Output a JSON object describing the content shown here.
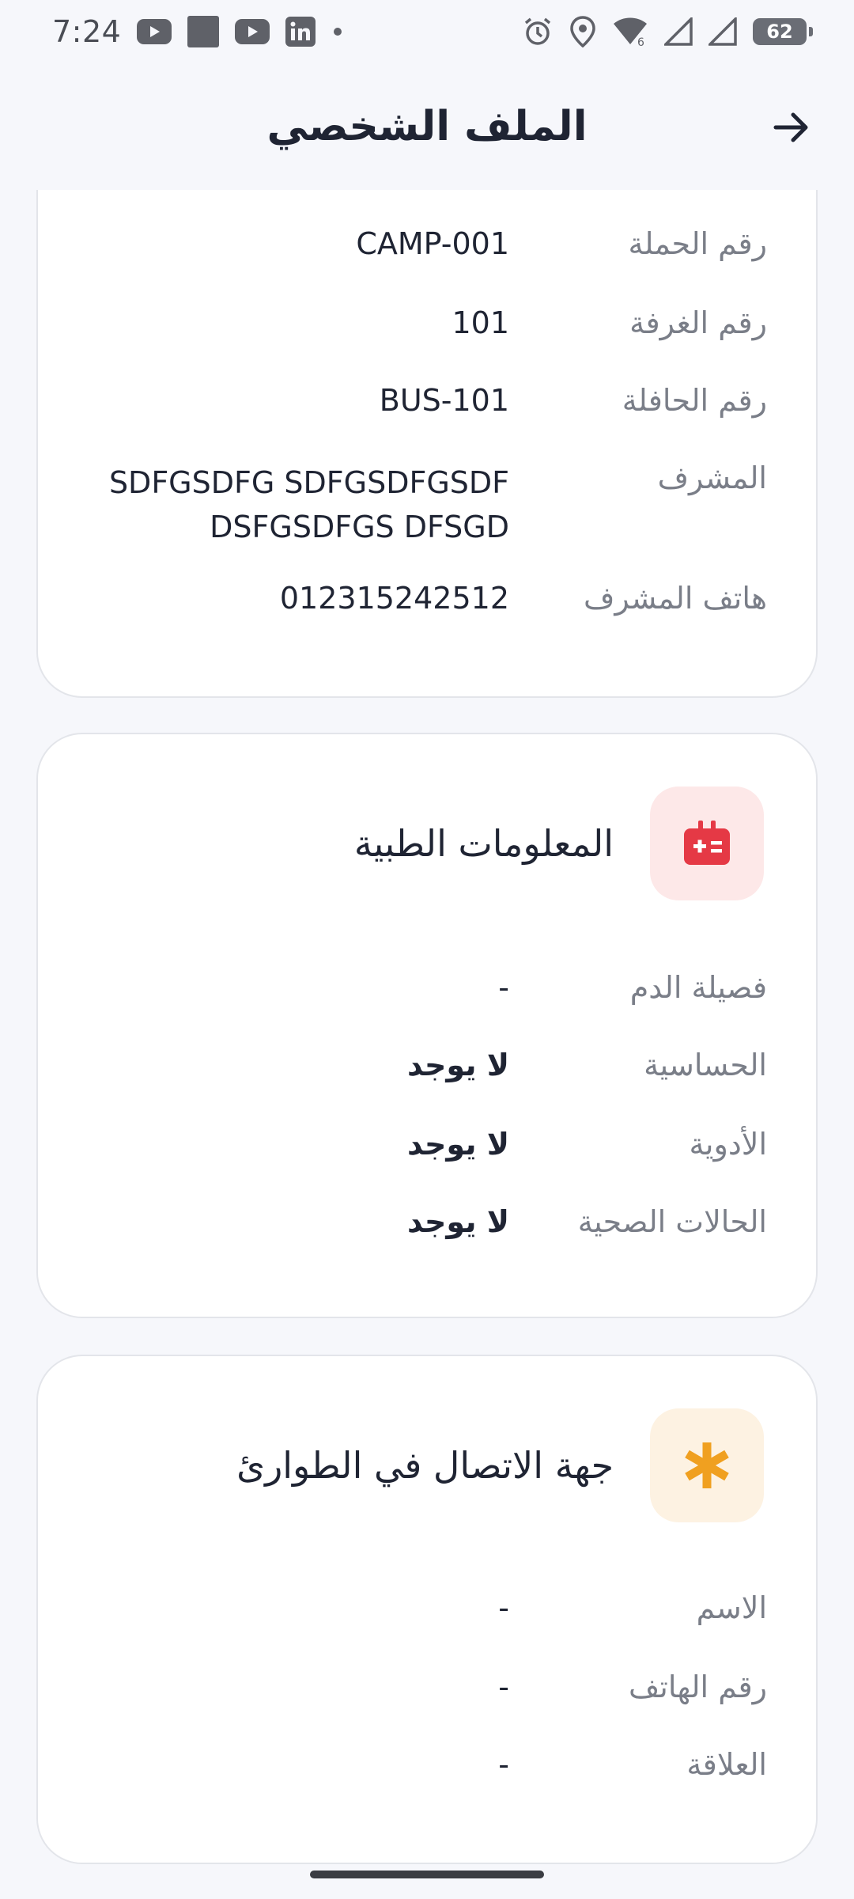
{
  "status_bar": {
    "time": "7:24",
    "battery": "62",
    "left_icons": [
      "youtube-icon",
      "gallery-icon",
      "youtube-icon",
      "linkedin-icon",
      "dot-icon"
    ],
    "right_icons": [
      "alarm-icon",
      "location-icon",
      "wifi-icon",
      "signal-icon",
      "signal-icon",
      "battery-icon"
    ]
  },
  "header": {
    "title": "الملف الشخصي",
    "back_icon": "arrow-right-icon"
  },
  "camp_info": {
    "rows": [
      {
        "label": "رقم الحملة",
        "value": "CAMP-001"
      },
      {
        "label": "رقم الغرفة",
        "value": "101"
      },
      {
        "label": "رقم الحافلة",
        "value": "BUS-101"
      },
      {
        "label": "المشرف",
        "value": "SDFGSDFG SDFGSDFGSDF DSFGSDFGS DFSGD"
      },
      {
        "label": "هاتف المشرف",
        "value": "012315242512"
      }
    ]
  },
  "medical": {
    "title": "المعلومات الطبية",
    "icon": "medical-kit-icon",
    "icon_color": "#e53945",
    "rows": [
      {
        "label": "فصيلة الدم",
        "value": "-"
      },
      {
        "label": "الحساسية",
        "value": "لا يوجد"
      },
      {
        "label": "الأدوية",
        "value": "لا يوجد"
      },
      {
        "label": "الحالات الصحية",
        "value": "لا يوجد"
      }
    ]
  },
  "emergency": {
    "title": "جهة الاتصال في الطوارئ",
    "icon": "asterisk-icon",
    "icon_color": "#f0a020",
    "rows": [
      {
        "label": "الاسم",
        "value": "-"
      },
      {
        "label": "رقم الهاتف",
        "value": "-"
      },
      {
        "label": "العلاقة",
        "value": "-"
      }
    ]
  }
}
